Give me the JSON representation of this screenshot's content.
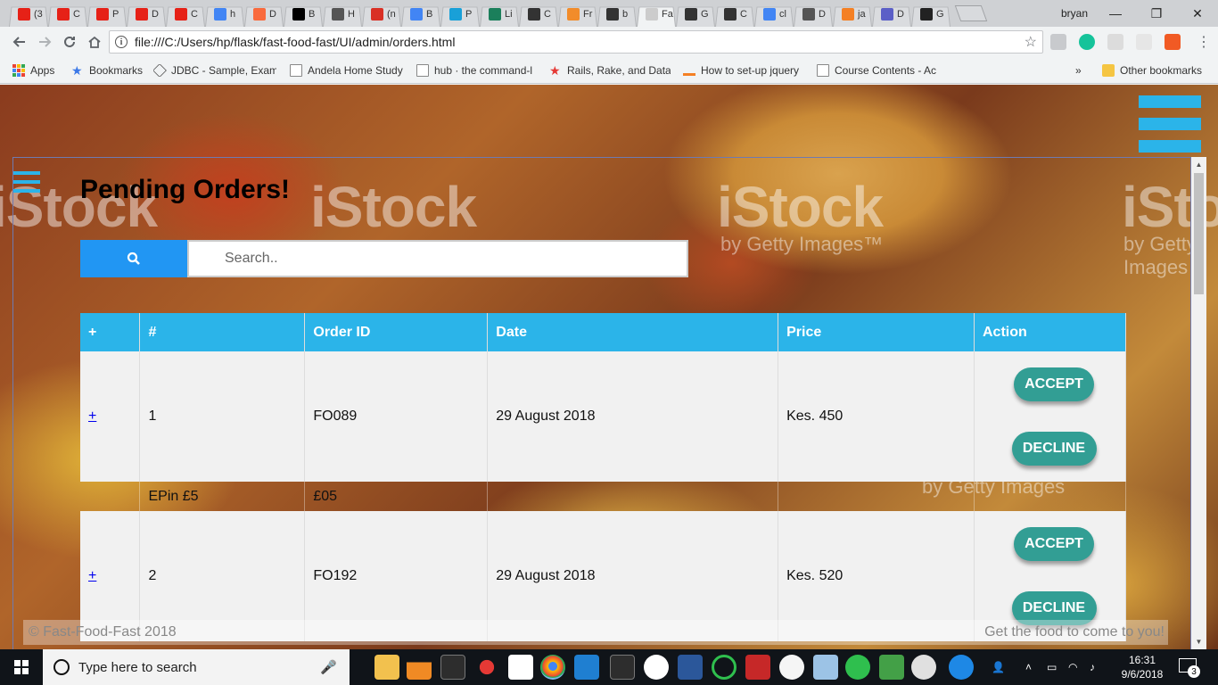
{
  "browser": {
    "tabs": [
      {
        "label": "(3",
        "color": "#e62117"
      },
      {
        "label": "C",
        "color": "#e62117"
      },
      {
        "label": "P",
        "color": "#e62117"
      },
      {
        "label": "D",
        "color": "#e62117"
      },
      {
        "label": "C",
        "color": "#e62117"
      },
      {
        "label": "h",
        "color": "#4285f4"
      },
      {
        "label": "D",
        "color": "#f96a3d"
      },
      {
        "label": "B",
        "color": "#000000"
      },
      {
        "label": "H",
        "color": "#555555"
      },
      {
        "label": "(n",
        "color": "#d93025"
      },
      {
        "label": "B",
        "color": "#4285f4"
      },
      {
        "label": "P",
        "color": "#19a0d8"
      },
      {
        "label": "Li",
        "color": "#1b7f5b"
      },
      {
        "label": "C",
        "color": "#333333"
      },
      {
        "label": "Fr",
        "color": "#f28c2a"
      },
      {
        "label": "b",
        "color": "#333333"
      },
      {
        "label": "Fa",
        "color": "#cccccc"
      },
      {
        "label": "G",
        "color": "#333333"
      },
      {
        "label": "C",
        "color": "#333333"
      },
      {
        "label": "cl",
        "color": "#4285f4"
      },
      {
        "label": "D",
        "color": "#555555"
      },
      {
        "label": "ja",
        "color": "#f48024"
      },
      {
        "label": "D",
        "color": "#5b5fc7"
      },
      {
        "label": "G",
        "color": "#222222"
      }
    ],
    "profile_name": "bryan",
    "window_controls": {
      "minimize": "—",
      "restore": "❐",
      "close": "✕"
    },
    "url": "file:///C:/Users/hp/flask/fast-food-fast/UI/admin/orders.html",
    "bookmarks": {
      "apps": "Apps",
      "bookmarks": "Bookmarks",
      "jdbc": "JDBC - Sample, Exam",
      "andela": "Andela Home Study",
      "hub": "hub · the command-l",
      "rails": "Rails, Rake, and Datal",
      "jquery": "How to set-up jquery",
      "course": "Course Contents - Ac",
      "chevron": "»",
      "other": "Other bookmarks"
    }
  },
  "page": {
    "title": "Pending Orders!",
    "search": {
      "placeholder": "Search.."
    },
    "table": {
      "headers": [
        "+",
        "#",
        "Order ID",
        "Date",
        "Price",
        "Action"
      ],
      "orders": [
        {
          "expand": "+",
          "num": "1",
          "order_id": "FO089",
          "date": "29 August 2018",
          "price": "Kes. 450",
          "accept": "ACCEPT",
          "decline": "DECLINE",
          "detail": {
            "item": "EPin £5",
            "amount": "£05"
          }
        },
        {
          "expand": "+",
          "num": "2",
          "order_id": "FO192",
          "date": "29 August 2018",
          "price": "Kes. 520",
          "accept": "ACCEPT",
          "decline": "DECLINE"
        }
      ]
    },
    "footer": {
      "left": "© Fast-Food-Fast 2018",
      "right": "Get the food to come to you!"
    },
    "watermark": {
      "brand": "iStock",
      "sub": "by Getty Images™",
      "sub2": "by Getty Images"
    }
  },
  "taskbar": {
    "search_placeholder": "Type here to search",
    "time": "16:31",
    "date": "9/6/2018",
    "notifications": "3"
  },
  "colors": {
    "accent": "#2bb4e9",
    "button": "#329e94",
    "search_button": "#2196f3"
  }
}
